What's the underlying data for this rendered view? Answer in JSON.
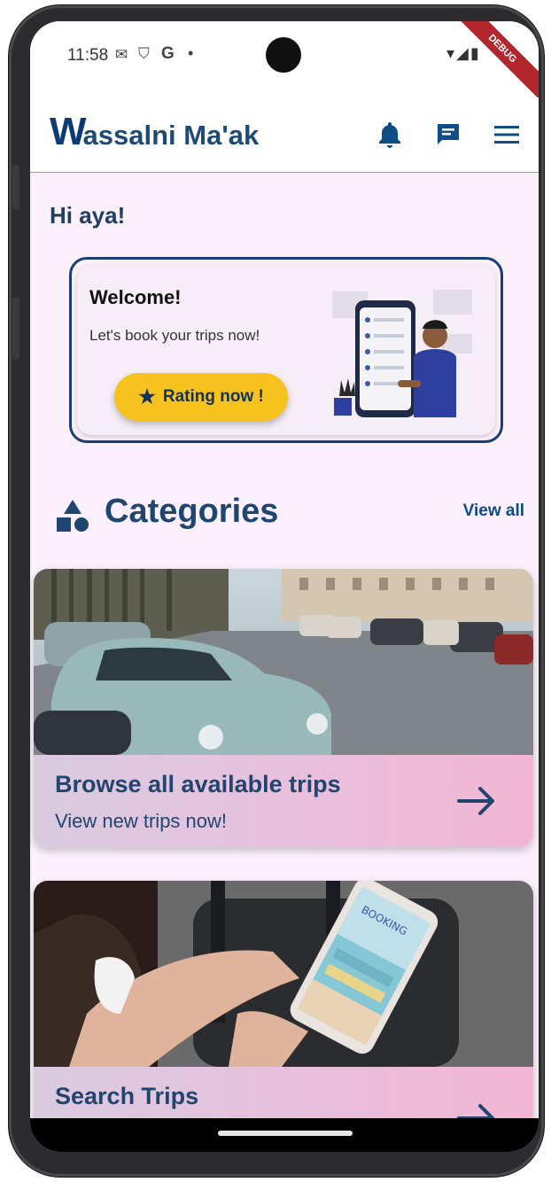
{
  "status": {
    "time": "11:58",
    "left_icons": [
      "mail-icon",
      "shield-icon",
      "google-icon",
      "dot-icon"
    ],
    "right_icons": [
      "wifi-icon",
      "signal-icon",
      "battery-icon"
    ],
    "debug_banner": "DEBUG"
  },
  "appbar": {
    "logo_letter": "W",
    "logo_text": "assalni Ma'ak",
    "icons": [
      "bell-icon",
      "chat-icon",
      "menu-icon"
    ]
  },
  "greeting": "Hi aya!",
  "welcome_card": {
    "title": "Welcome!",
    "subtitle": "Let's book your trips now!",
    "button_label": "Rating now !",
    "button_icon": "star-icon"
  },
  "categories": {
    "title": "Categories",
    "view_all": "View all",
    "icon": "shapes-icon"
  },
  "cards": [
    {
      "title": "Browse all available trips",
      "subtitle": "View new trips now!",
      "image": "vintage-cars-street-photo"
    },
    {
      "title": "Search Trips",
      "subtitle": "",
      "image": "phone-booking-app-photo"
    }
  ],
  "colors": {
    "primary": "#1f4670",
    "accent_yellow": "#f7c21d",
    "background": "#fbf0fb",
    "band_start": "#d9cbe0",
    "band_end": "#f2b6d2"
  }
}
